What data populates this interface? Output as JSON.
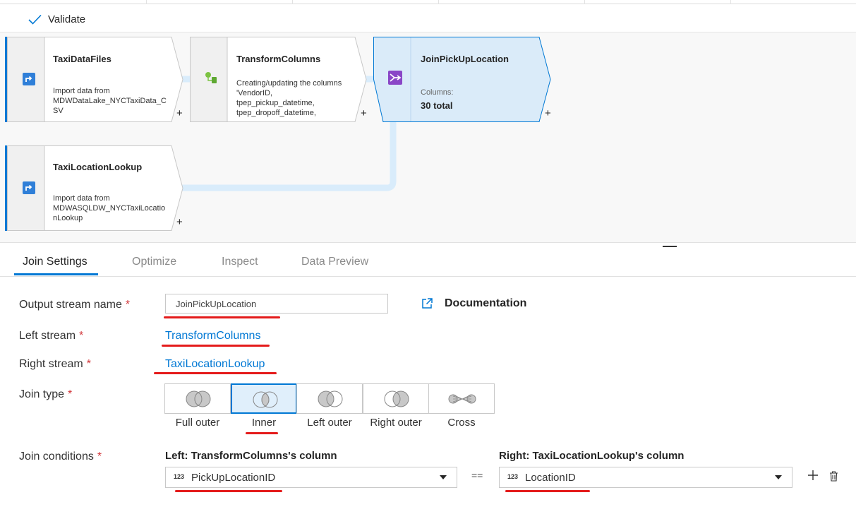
{
  "toolbar": {
    "validate_label": "Validate"
  },
  "nodes": {
    "taxi_data_files": {
      "title": "TaxiDataFiles",
      "desc_line1": "Import data from",
      "desc_line2": "MDWDataLake_NYCTaxiData_C",
      "desc_line3": "SV"
    },
    "transform_columns": {
      "title": "TransformColumns",
      "desc_line1": "Creating/updating the columns",
      "desc_line2": "'VendorID,",
      "desc_line3": "tpep_pickup_datetime,",
      "desc_line4": "tpep_dropoff_datetime,"
    },
    "join_pickup": {
      "title": "JoinPickUpLocation",
      "columns_label": "Columns:",
      "columns_value": "30 total"
    },
    "taxi_location_lookup": {
      "title": "TaxiLocationLookup",
      "desc_line1": "Import data from",
      "desc_line2": "MDWASQLDW_NYCTaxiLocatio",
      "desc_line3": "nLookup"
    },
    "plus": "+"
  },
  "tabs": [
    "Join Settings",
    "Optimize",
    "Inspect",
    "Data Preview"
  ],
  "form": {
    "output_label": "Output stream name",
    "output_value": "JoinPickUpLocation",
    "required_mark": "*",
    "documentation": "Documentation",
    "left_label": "Left stream",
    "left_value": "TransformColumns",
    "right_label": "Right stream",
    "right_value": "TaxiLocationLookup",
    "join_type_label": "Join type",
    "join_types": [
      "Full outer",
      "Inner",
      "Left outer",
      "Right outer",
      "Cross"
    ],
    "selected_join_type": "Inner",
    "conditions_label": "Join conditions",
    "left_col_header": "Left: TransformColumns's column",
    "right_col_header": "Right: TaxiLocationLookup's column",
    "left_col_type": "123",
    "left_col_value": "PickUpLocationID",
    "right_col_type": "123",
    "right_col_value": "LocationID",
    "equals": "=="
  },
  "colors": {
    "accent": "#0078d4",
    "annotation": "#e41b1b",
    "selected_node_fill": "#daebf9",
    "link": "#d9ecfb"
  }
}
